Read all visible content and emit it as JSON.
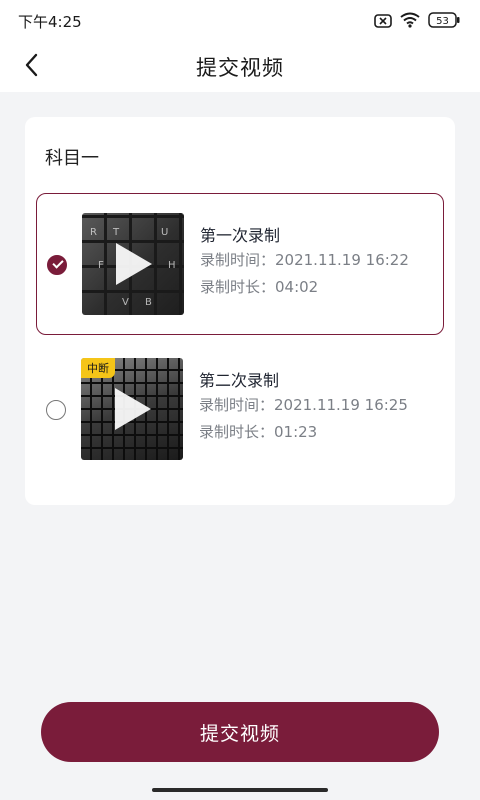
{
  "status_bar": {
    "time": "下午4:25",
    "battery": "53"
  },
  "header": {
    "title": "提交视频"
  },
  "card": {
    "subject": "科目一",
    "recordings": [
      {
        "name": "第一次录制",
        "record_time": "录制时间：2021.11.19 16:22",
        "duration": "录制时长：04:02",
        "selected": true,
        "badge": ""
      },
      {
        "name": "第二次录制",
        "record_time": "录制时间：2021.11.19 16:25",
        "duration": "录制时长：01:23",
        "selected": false,
        "badge": "中断"
      }
    ]
  },
  "footer": {
    "submit_label": "提交视频"
  },
  "colors": {
    "accent": "#7a1c3a",
    "badge": "#f5c518"
  }
}
